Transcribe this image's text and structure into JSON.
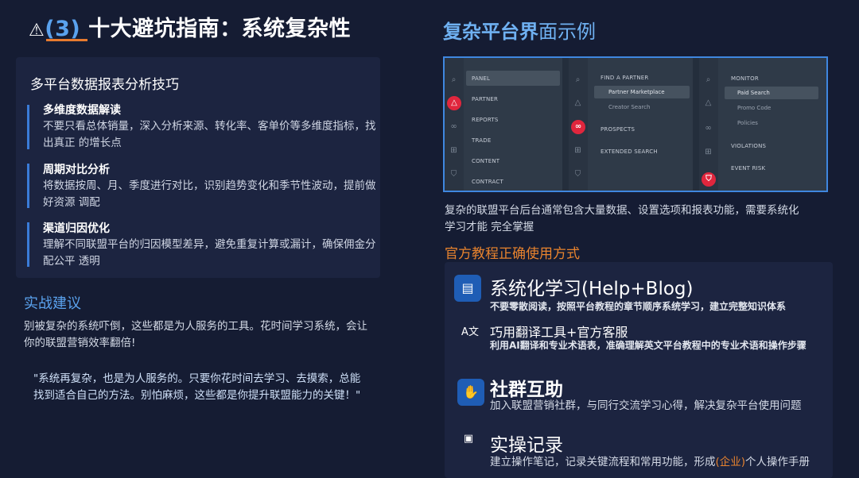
{
  "slide": {
    "warning_glyph": "⚠",
    "title_num": "(3)",
    "title_text": "十大避坑指南：系统复杂性"
  },
  "tips": {
    "heading": "多平台数据报表分析技巧",
    "items": [
      {
        "title": "多维度数据解读",
        "desc": "不要只看总体销量，深入分析来源、转化率、客单价等多维度指标，找出真正 的增长点"
      },
      {
        "title": "周期对比分析",
        "desc": "将数据按周、月、季度进行对比，识别趋势变化和季节性波动，提前做好资源 调配"
      },
      {
        "title": "渠道归因优化",
        "desc": "理解不同联盟平台的归因模型差异，避免重复计算或漏计，确保佣金分配公平 透明"
      }
    ]
  },
  "advice": {
    "title": "实战建议",
    "text": "别被复杂的系统吓倒，这些都是为人服务的工具。花时间学习系统，会让你的联盟营销效率翻倍!",
    "quote": "\"系统再复杂，也是为人服务的。只要你花时间去学习、去摸索，总能找到适合自己的方法。别怕麻烦，这些都是你提升联盟能力的关键！\""
  },
  "platform": {
    "title_bold": "复杂平台界",
    "title_light": "面示例",
    "desc": "复杂的联盟平台后台通常包含大量数据、设置选项和报表功能，需要系统化学习才能 完全掌握",
    "screenshot": {
      "panel1": [
        "PANEL",
        "PARTNER",
        "REPORTS",
        "TRADE",
        "CONTENT",
        "CONTRACT"
      ],
      "panel2_main": [
        "FIND A PARTNER",
        "PROSPECTS",
        "EXTENDED SEARCH"
      ],
      "panel2_sub": [
        "Partner Marketplace",
        "Creator Search"
      ],
      "panel3_main": [
        "MONITOR",
        "VIOLATIONS",
        "EVENT RISK"
      ],
      "panel3_sub": [
        "Paid Search",
        "Promo Code",
        "Policies"
      ]
    }
  },
  "tutorial": {
    "title": "官方教程正确使用方式",
    "methods": [
      {
        "title": "系统化学习(Help+Blog)",
        "desc": "不要零散阅读，按照平台教程的章节顺序系统学习，建立完整知识体系",
        "icon": "book-icon"
      },
      {
        "title": "巧用翻译工具+官方客服",
        "desc": "利用AI翻译和专业术语表，准确理解英文平台教程中的专业术语和操作步骤",
        "icon": "translate-icon"
      },
      {
        "title": "社群互助",
        "desc": "加入联盟营销社群，与同行交流学习心得，解决复杂平台使用问题",
        "icon": "handshake-icon"
      },
      {
        "title": "实操记录",
        "desc_pre": "建立操作笔记，记录关键流程和常用功能，形成",
        "desc_hl": "(企业)",
        "desc_post": "个人操作手册",
        "icon": "clipboard-icon"
      }
    ]
  },
  "colors": {
    "background": "#151c33",
    "card": "#1c2440",
    "accent_blue": "#5aa2ee",
    "accent_orange": "#e8832e",
    "tip_bar": "#3a7bd8"
  }
}
